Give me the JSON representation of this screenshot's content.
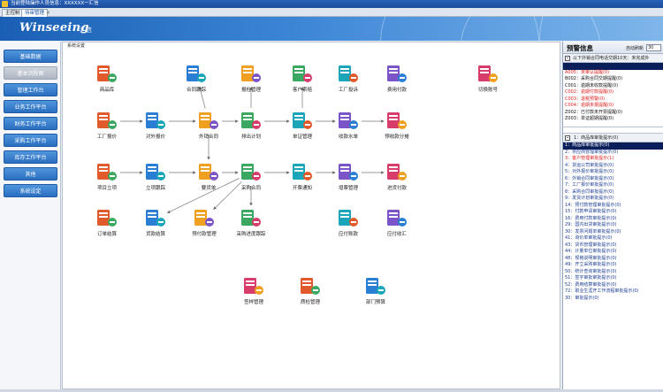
{
  "titlebar": {
    "text": "当前登陆操作人员信息：XXXXXX一汇信"
  },
  "tabs": [
    {
      "label": "主控制"
    },
    {
      "label": "待审管理"
    }
  ],
  "banner": {
    "logo": "Winseeing",
    "logo_cn": "汇信"
  },
  "sidebar": {
    "items": [
      {
        "label": "基础数据",
        "style": "blue"
      },
      {
        "label": "基本流程图",
        "style": "light"
      },
      {
        "label": "管理工作台",
        "style": "blue"
      },
      {
        "label": "业务工作平台",
        "style": "blue"
      },
      {
        "label": "财务工作平台",
        "style": "blue"
      },
      {
        "label": "采购工作平台",
        "style": "blue"
      },
      {
        "label": "库存工作平台",
        "style": "blue"
      },
      {
        "label": "其他",
        "style": "blue"
      },
      {
        "label": "系统设定",
        "style": "blue"
      }
    ]
  },
  "main": {
    "breadcrumb": "系统设置",
    "nodes": [
      {
        "label": "商品库",
        "icon": "warehouse-icon"
      },
      {
        "label": "合同跟踪",
        "icon": "contract-track-icon"
      },
      {
        "label": "报检管理",
        "icon": "inspection-icon"
      },
      {
        "label": "客户索赔",
        "icon": "claim-icon"
      },
      {
        "label": "工厂投诉",
        "icon": "complaint-icon"
      },
      {
        "label": "费用付款",
        "icon": "expense-pay-icon"
      },
      {
        "label": "切换账号",
        "icon": "switch-user-icon"
      },
      {
        "label": "工厂报价",
        "icon": "factory-quote-icon"
      },
      {
        "label": "对外报价",
        "icon": "quote-icon"
      },
      {
        "label": "外销合同",
        "icon": "sales-contract-icon"
      },
      {
        "label": "排出计划",
        "icon": "schedule-icon"
      },
      {
        "label": "单证管理",
        "icon": "document-icon"
      },
      {
        "label": "收款水单",
        "icon": "receipt-icon"
      },
      {
        "label": "预收款分摊",
        "icon": "prepay-icon"
      },
      {
        "label": "项目立项",
        "icon": "project-icon"
      },
      {
        "label": "立项跟踪",
        "icon": "project-track-icon"
      },
      {
        "label": "要货单",
        "icon": "request-icon"
      },
      {
        "label": "采购合同",
        "icon": "purchase-contract-icon"
      },
      {
        "label": "开票通知",
        "icon": "invoice-icon"
      },
      {
        "label": "增票管理",
        "icon": "vat-icon"
      },
      {
        "label": "进货付款",
        "icon": "purchase-pay-icon"
      },
      {
        "label": "订单结算",
        "icon": "order-settle-icon"
      },
      {
        "label": "货款结算",
        "icon": "payment-settle-icon"
      },
      {
        "label": "预付款管理",
        "icon": "prepaid-icon"
      },
      {
        "label": "采购进度跟踪",
        "icon": "progress-icon"
      },
      {
        "label": "应付账款",
        "icon": "payable-icon"
      },
      {
        "label": "应付收汇",
        "icon": "forex-icon"
      },
      {
        "label": "签样管理",
        "icon": "sample-icon"
      },
      {
        "label": "质检管理",
        "icon": "qc-icon"
      },
      {
        "label": "部门预算",
        "icon": "budget-icon"
      }
    ]
  },
  "right": {
    "title": "预警信息",
    "auto_refresh_label": "自动刷新",
    "refresh_value": "30",
    "section1": "以下外销合同电话交期10天：未完成外",
    "warnings": [
      {
        "text": "",
        "style": "sel"
      },
      {
        "text": "A005：未审认提醒(0)",
        "style": "red"
      },
      {
        "text": "B002：采购合同交期提醒(0)",
        "style": "blk"
      },
      {
        "text": "C001：逾期未收款提醒(0)",
        "style": "blk"
      },
      {
        "text": "C002：逾期付款提醒(0)",
        "style": "red"
      },
      {
        "text": "C003：退税预警(0)",
        "style": "red"
      },
      {
        "text": "C004：逾期未报提醒(0)",
        "style": "red"
      },
      {
        "text": "Z002：已付款未开票提醒(0)",
        "style": "blk"
      },
      {
        "text": "Z003：单证超期提醒(0)",
        "style": "blk"
      }
    ],
    "section2": "1：商品库审批提示(0)",
    "audits": [
      {
        "text": "1：商品库审批提示(0)",
        "style": "sel"
      },
      {
        "text": "2：供应商管理审批提示(0)",
        "style": ""
      },
      {
        "text": "3：客户管理审批提示(1)",
        "style": "red"
      },
      {
        "text": "4：货运公司审批提示(0)",
        "style": ""
      },
      {
        "text": "5：对外报价审批提示(0)",
        "style": ""
      },
      {
        "text": "6：外销合同审批提示(0)",
        "style": ""
      },
      {
        "text": "7：工厂报价审批提示(0)",
        "style": ""
      },
      {
        "text": "8：采购合同审批提示(0)",
        "style": ""
      },
      {
        "text": "9：发货计划审批提示(0)",
        "style": ""
      },
      {
        "text": "14：预付款管理审批提示(0)",
        "style": ""
      },
      {
        "text": "15：付款申请审批提示(0)",
        "style": ""
      },
      {
        "text": "16：费用付款审批提示(0)",
        "style": ""
      },
      {
        "text": "29：国内出货审批提示(0)",
        "style": ""
      },
      {
        "text": "30：发票问题单审批提示(0)",
        "style": ""
      },
      {
        "text": "41：询价单审批提示(0)",
        "style": ""
      },
      {
        "text": "43：货币管理审批提示(0)",
        "style": ""
      },
      {
        "text": "44：计量单位审批提示(0)",
        "style": ""
      },
      {
        "text": "48：规格说明审批提示(0)",
        "style": ""
      },
      {
        "text": "49：开立采购审批提示(0)",
        "style": ""
      },
      {
        "text": "50：统计查询审批提示(0)",
        "style": ""
      },
      {
        "text": "51：签字审批审批提示(0)",
        "style": ""
      },
      {
        "text": "52：费用结算审批提示(0)",
        "style": ""
      },
      {
        "text": "72：职业生涯开工作流程审批提示(0)",
        "style": ""
      },
      {
        "text": "30：审批提示(0)",
        "style": ""
      }
    ]
  },
  "colors": {
    "accent": "#2a6fc0",
    "banner_start": "#1a5fb4",
    "warning_red": "#e02020",
    "selection": "#0a1e5a"
  }
}
